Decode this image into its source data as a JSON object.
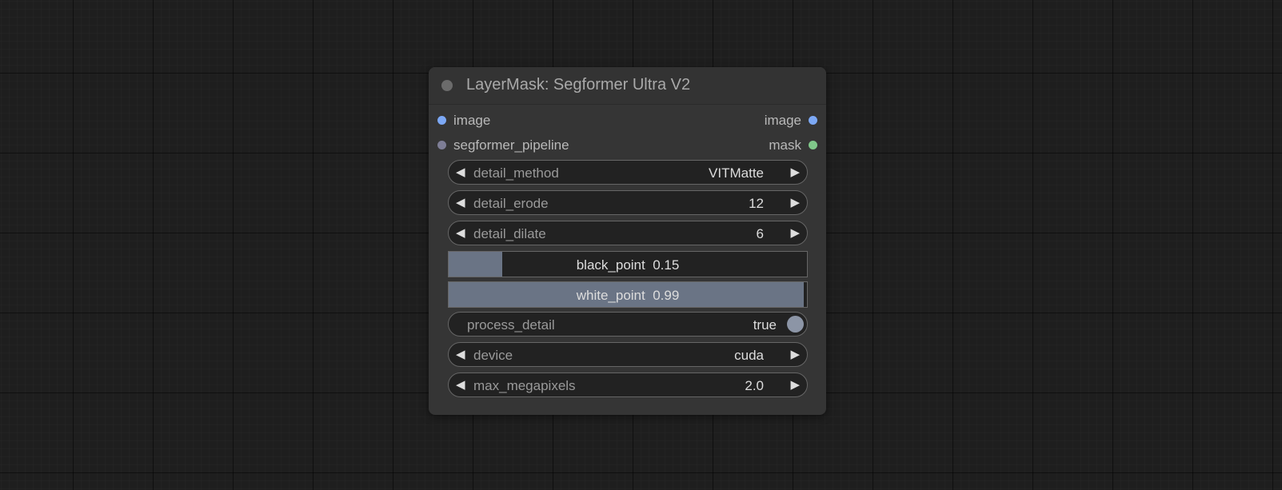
{
  "node": {
    "title": "LayerMask: Segformer Ultra V2",
    "inputs": [
      {
        "label": "image",
        "color": "#7ca8f5"
      },
      {
        "label": "segformer_pipeline",
        "color": "#7e7e96"
      }
    ],
    "outputs": [
      {
        "label": "image",
        "color": "#7ca8f5"
      },
      {
        "label": "mask",
        "color": "#80c88a"
      }
    ],
    "widgets": {
      "detail_method": {
        "label": "detail_method",
        "value": "VITMatte"
      },
      "detail_erode": {
        "label": "detail_erode",
        "value": "12"
      },
      "detail_dilate": {
        "label": "detail_dilate",
        "value": "6"
      },
      "black_point": {
        "label": "black_point",
        "value": "0.15",
        "fill": 0.15
      },
      "white_point": {
        "label": "white_point",
        "value": "0.99",
        "fill": 0.99
      },
      "process_detail": {
        "label": "process_detail",
        "value": "true"
      },
      "device": {
        "label": "device",
        "value": "cuda"
      },
      "max_megapixels": {
        "label": "max_megapixels",
        "value": "2.0"
      }
    }
  },
  "icons": {
    "decrement": "◀",
    "increment": "▶"
  },
  "colors": {
    "canvas_bg": "#1e1e1e",
    "node_bg": "#353535",
    "slider_fill": "#6a7485",
    "toggle_knob": "#8c95a6"
  }
}
